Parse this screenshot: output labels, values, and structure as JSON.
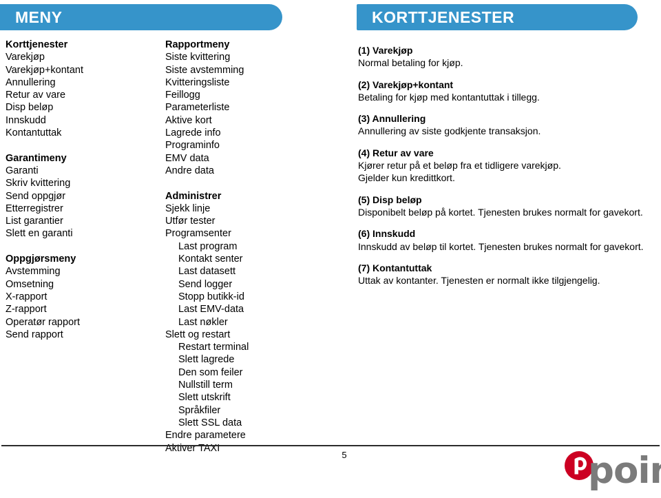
{
  "page": {
    "number": "5",
    "accent_color": "#3694ca",
    "logo_mark_color": "#cc0022",
    "logo_word_color": "#7b7b7b",
    "logo_word": "point",
    "logo_mark_letter": "p"
  },
  "left_bar": {
    "title": "MENY"
  },
  "right_bar": {
    "title": "KORTTJENESTER"
  },
  "menu_left": {
    "groups": [
      {
        "heading": "Korttjenester",
        "items": [
          {
            "label": "Varekjøp",
            "indent": false
          },
          {
            "label": "Varekjøp+kontant",
            "indent": false
          },
          {
            "label": "Annullering",
            "indent": false
          },
          {
            "label": "Retur av vare",
            "indent": false
          },
          {
            "label": "Disp beløp",
            "indent": false
          },
          {
            "label": "Innskudd",
            "indent": false
          },
          {
            "label": "Kontantuttak",
            "indent": false
          }
        ]
      },
      {
        "heading": "Garantimeny",
        "items": [
          {
            "label": "Garanti",
            "indent": false
          },
          {
            "label": "Skriv kvittering",
            "indent": false
          },
          {
            "label": "Send oppgjør",
            "indent": false
          },
          {
            "label": "Etterregistrer",
            "indent": false
          },
          {
            "label": "List garantier",
            "indent": false
          },
          {
            "label": "Slett en garanti",
            "indent": false
          }
        ]
      },
      {
        "heading": "Oppgjørsmeny",
        "items": [
          {
            "label": "Avstemming",
            "indent": false
          },
          {
            "label": "Omsetning",
            "indent": false
          },
          {
            "label": "X-rapport",
            "indent": false
          },
          {
            "label": "Z-rapport",
            "indent": false
          },
          {
            "label": "Operatør rapport",
            "indent": false
          },
          {
            "label": "Send rapport",
            "indent": false
          }
        ]
      }
    ]
  },
  "menu_mid": {
    "groups": [
      {
        "heading": "Rapportmeny",
        "items": [
          {
            "label": "Siste kvittering",
            "indent": false
          },
          {
            "label": "Siste avstemming",
            "indent": false
          },
          {
            "label": "Kvitteringsliste",
            "indent": false
          },
          {
            "label": "Feillogg",
            "indent": false
          },
          {
            "label": "Parameterliste",
            "indent": false
          },
          {
            "label": "Aktive kort",
            "indent": false
          },
          {
            "label": "Lagrede info",
            "indent": false
          },
          {
            "label": "Programinfo",
            "indent": false
          },
          {
            "label": "EMV data",
            "indent": false
          },
          {
            "label": "Andre data",
            "indent": false
          }
        ]
      },
      {
        "heading": "Administrer",
        "items": [
          {
            "label": "Sjekk linje",
            "indent": false
          },
          {
            "label": "Utfør tester",
            "indent": false
          },
          {
            "label": "Programsenter",
            "indent": false
          },
          {
            "label": "Last program",
            "indent": true
          },
          {
            "label": "Kontakt senter",
            "indent": true
          },
          {
            "label": "Last datasett",
            "indent": true
          },
          {
            "label": "Send logger",
            "indent": true
          },
          {
            "label": "Stopp butikk-id",
            "indent": true
          },
          {
            "label": "Last EMV-data",
            "indent": true
          },
          {
            "label": "Last nøkler",
            "indent": true
          },
          {
            "label": "Slett og restart",
            "indent": false
          },
          {
            "label": "Restart terminal",
            "indent": true
          },
          {
            "label": "Slett lagrede",
            "indent": true
          },
          {
            "label": "Den som feiler",
            "indent": true
          },
          {
            "label": "Nullstill term",
            "indent": true
          },
          {
            "label": "Slett utskrift",
            "indent": true
          },
          {
            "label": "Språkfiler",
            "indent": true
          },
          {
            "label": "Slett SSL data",
            "indent": true
          },
          {
            "label": "Endre parametere",
            "indent": false
          },
          {
            "label": "Aktiver TAXI",
            "indent": false
          }
        ]
      }
    ]
  },
  "descriptions": [
    {
      "title": "(1) Varekjøp",
      "lines": [
        "Normal betaling for kjøp."
      ]
    },
    {
      "title": "(2) Varekjøp+kontant",
      "lines": [
        "Betaling for kjøp med kontantuttak i tillegg."
      ]
    },
    {
      "title": "(3) Annullering",
      "lines": [
        "Annullering av siste godkjente transaksjon."
      ]
    },
    {
      "title": "(4) Retur av vare",
      "lines": [
        "Kjører retur på et beløp fra et tidligere varekjøp.",
        "Gjelder kun kredittkort."
      ]
    },
    {
      "title": "(5) Disp beløp",
      "lines": [
        "Disponibelt beløp på kortet. Tjenesten brukes normalt for gavekort."
      ]
    },
    {
      "title": "(6) Innskudd",
      "lines": [
        "Innskudd av beløp til kortet. Tjenesten brukes normalt for gavekort."
      ]
    },
    {
      "title": "(7) Kontantuttak",
      "lines": [
        "Uttak av kontanter. Tjenesten er normalt ikke tilgjengelig."
      ]
    }
  ]
}
